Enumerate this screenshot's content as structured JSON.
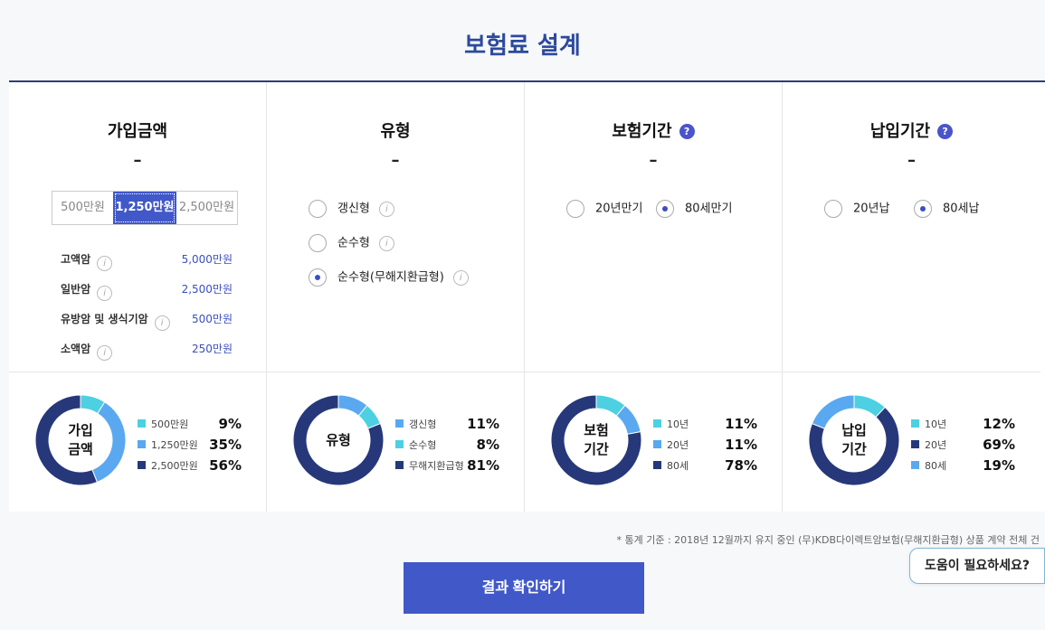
{
  "page": {
    "title": "보험료 설계"
  },
  "columns": [
    {
      "title": "가입금액",
      "dash": "–"
    },
    {
      "title": "유형",
      "dash": "–"
    },
    {
      "title": "보험기간",
      "dash": "–",
      "help_icon": "?"
    },
    {
      "title": "납입기간",
      "dash": "–",
      "help_icon": "?"
    }
  ],
  "amount": {
    "options": [
      "500만원",
      "1,250만원",
      "2,500만원"
    ],
    "selected": "1,250만원",
    "info_icon": "i",
    "details": [
      {
        "label": "고액암",
        "value": "5,000만원"
      },
      {
        "label": "일반암",
        "value": "2,500만원"
      },
      {
        "label": "유방암 및 생식기암",
        "value": "500만원"
      },
      {
        "label": "소액암",
        "value": "250만원"
      }
    ]
  },
  "type": {
    "options": [
      {
        "label": "갱신형",
        "selected": false
      },
      {
        "label": "순수형",
        "selected": false
      },
      {
        "label": "순수형(무해지환급형)",
        "selected": true
      }
    ],
    "info_icon": "i"
  },
  "period": {
    "options": [
      {
        "label": "20년만기",
        "selected": false
      },
      {
        "label": "80세만기",
        "selected": true
      }
    ]
  },
  "payment": {
    "options": [
      {
        "label": "20년납",
        "selected": false
      },
      {
        "label": "80세납",
        "selected": true
      }
    ]
  },
  "chart_data": [
    {
      "type": "pie",
      "title": "가입\n금액",
      "series": [
        {
          "name": "500만원",
          "value": 9,
          "label": "9%",
          "color": "#4dd0e1"
        },
        {
          "name": "1,250만원",
          "value": 35,
          "label": "35%",
          "color": "#5aa8f0"
        },
        {
          "name": "2,500만원",
          "value": 56,
          "label": "56%",
          "color": "#26387a"
        }
      ]
    },
    {
      "type": "pie",
      "title": "유형",
      "series": [
        {
          "name": "갱신형",
          "value": 11,
          "label": "11%",
          "color": "#5aa8f0"
        },
        {
          "name": "순수형",
          "value": 8,
          "label": "8%",
          "color": "#4dd0e1"
        },
        {
          "name": "무해지환급형",
          "value": 81,
          "label": "81%",
          "color": "#26387a"
        }
      ]
    },
    {
      "type": "pie",
      "title": "보험\n기간",
      "series": [
        {
          "name": "10년",
          "value": 11,
          "label": "11%",
          "color": "#4dd0e1"
        },
        {
          "name": "20년",
          "value": 11,
          "label": "11%",
          "color": "#5aa8f0"
        },
        {
          "name": "80세",
          "value": 78,
          "label": "78%",
          "color": "#26387a"
        }
      ]
    },
    {
      "type": "pie",
      "title": "납입\n기간",
      "series": [
        {
          "name": "10년",
          "value": 12,
          "label": "12%",
          "color": "#4dd0e1"
        },
        {
          "name": "20년",
          "value": 69,
          "label": "69%",
          "color": "#26387a"
        },
        {
          "name": "80세",
          "value": 19,
          "label": "19%",
          "color": "#5aa8f0"
        }
      ]
    }
  ],
  "footnote": "* 통계 기준 : 2018년 12월까지 유지 중인 (무)KDB다이렉트암보험(무해지환급형) 상품 계약 전체 건",
  "submit_label": "결과 확인하기",
  "help_label": "도움이 필요하세요?"
}
